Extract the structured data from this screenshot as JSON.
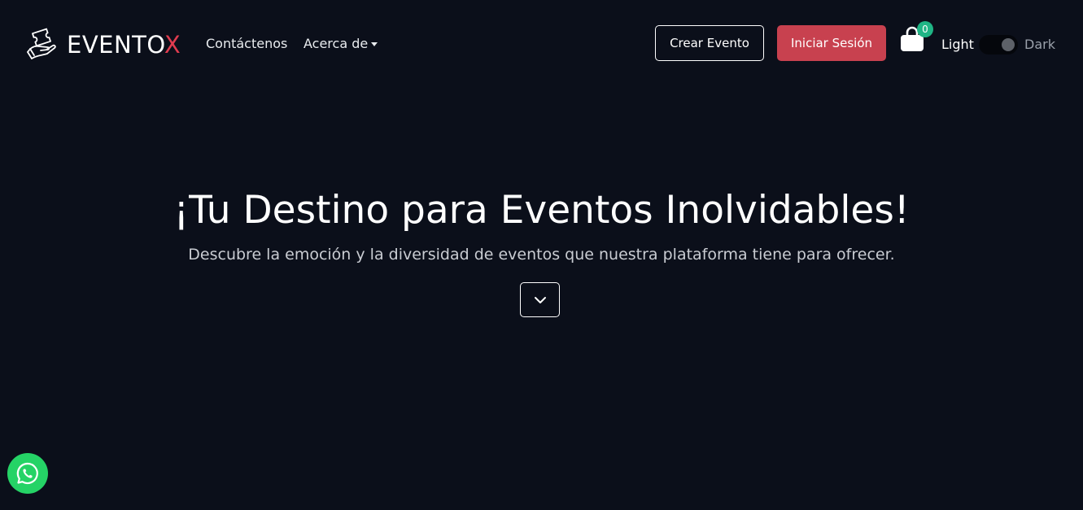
{
  "brand": {
    "text_main": "EVENTO",
    "text_accent": "X",
    "logo_icon": "hand-ticket-logo"
  },
  "nav": {
    "contact_label": "Contáctenos",
    "about_label": "Acerca de"
  },
  "actions": {
    "create_event_label": "Crear Evento",
    "login_label": "Iniciar Sesión",
    "cart_icon": "shopping-bag-icon",
    "cart_count": "0"
  },
  "theme": {
    "light_label": "Light",
    "dark_label": "Dark",
    "toggle_state": "off"
  },
  "hero": {
    "title": "¡Tu Destino para Eventos Inolvidables!",
    "subtitle": "Descubre la emoción y la diversidad de eventos que nuestra plataforma tiene para ofrecer.",
    "scroll_icon": "chevron-down-icon"
  },
  "floating": {
    "whatsapp_icon": "whatsapp-icon"
  },
  "colors": {
    "background": "#0b0f1a",
    "accent": "#c8414f",
    "badge": "#1fb585",
    "whatsapp": "#25d366"
  }
}
